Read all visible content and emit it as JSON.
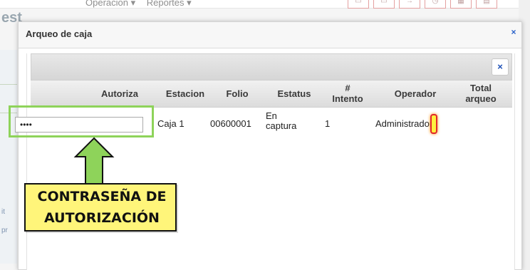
{
  "background": {
    "brand": "est",
    "nav": [
      "Operacion ▾",
      "Reportes ▾"
    ],
    "side_text": [
      "it",
      "pr"
    ]
  },
  "modal": {
    "title": "Arqueo de caja",
    "close_glyph": "×",
    "inner_close_glyph": "×"
  },
  "table": {
    "headers": {
      "autoriza": "Autoriza",
      "estacion": "Estacion",
      "folio": "Folio",
      "estatus": "Estatus",
      "intento_line1": "#",
      "intento_line2": "Intento",
      "operador": "Operador",
      "total_line1": "Total",
      "total_line2": "arqueo"
    },
    "row": {
      "password_value": "••••",
      "estacion": "Caja 1",
      "folio": "00600001",
      "estatus_line1": "En",
      "estatus_line2": "captura",
      "intento": "1",
      "operador": "Administrador"
    }
  },
  "annotation": {
    "line1": "CONTRASEÑA DE",
    "line2": "AUTORIZACIÓN",
    "highlight_color": "#8ed35a",
    "callout_color": "#fff57a"
  }
}
